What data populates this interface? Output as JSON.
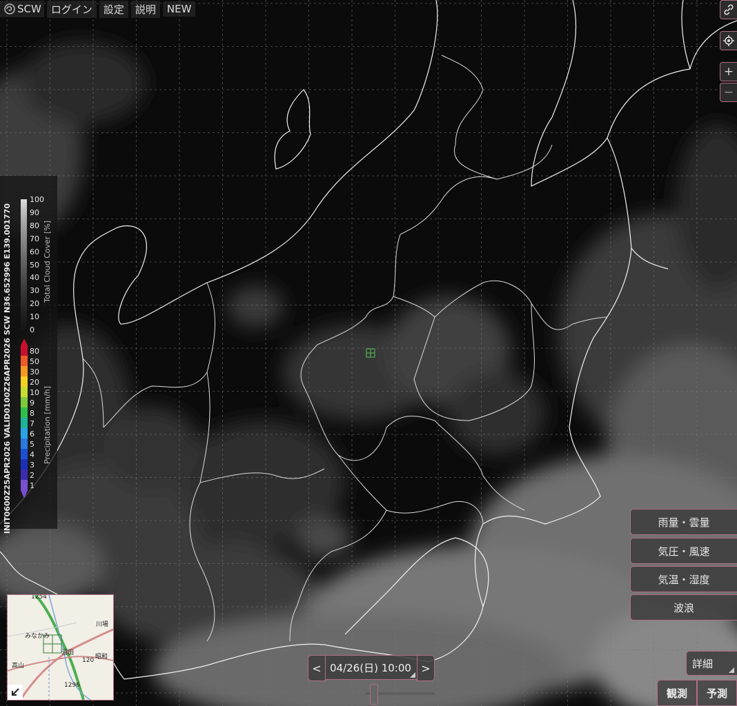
{
  "topbar": {
    "logo_text": "SCW",
    "menu": [
      "ログイン",
      "設定",
      "説明",
      "NEW"
    ]
  },
  "right_controls": {
    "link_icon": "link-icon",
    "locate_icon": "crosshair-icon",
    "zoom_in": "+",
    "zoom_out": "−"
  },
  "legend": {
    "run_info": "INIT0600Z25APR2026 VALID0100Z26APR2026 SCW N36.652996 E139.001770",
    "cloud_label": "Total Cloud Cover [%]",
    "cloud_ticks": [
      "100",
      "90",
      "80",
      "70",
      "60",
      "50",
      "40",
      "30",
      "20",
      "10",
      "0"
    ],
    "precip_label": "Precipitation [mm/h]",
    "precip_ticks": [
      "80",
      "50",
      "30",
      "20",
      "10",
      "9",
      "8",
      "7",
      "6",
      "5",
      "4",
      "3",
      "2",
      "1"
    ],
    "precip_colors": [
      "#c8102e",
      "#f05a28",
      "#f59a23",
      "#f6d220",
      "#c8dc32",
      "#7ccb3d",
      "#2fbf4a",
      "#1fb39a",
      "#29a3e6",
      "#2a78e0",
      "#1b4fd4",
      "#1c2fb8",
      "#3a2bb0",
      "#7a4fd0"
    ]
  },
  "layer_buttons": [
    "雨量・雲量",
    "気圧・風速",
    "気温・湿度",
    "波浪"
  ],
  "time": {
    "prev": "<",
    "value": "04/26(日) 10:00",
    "next": ">"
  },
  "slider": {
    "position_fraction": 0.06
  },
  "detail_button": "詳細",
  "mode_tabs": [
    "観測",
    "予測"
  ],
  "minimap": {
    "labels": [
      "川場",
      "みなかみ",
      "沼田",
      "昭和",
      "高山",
      "1296",
      "1254",
      "120"
    ]
  }
}
